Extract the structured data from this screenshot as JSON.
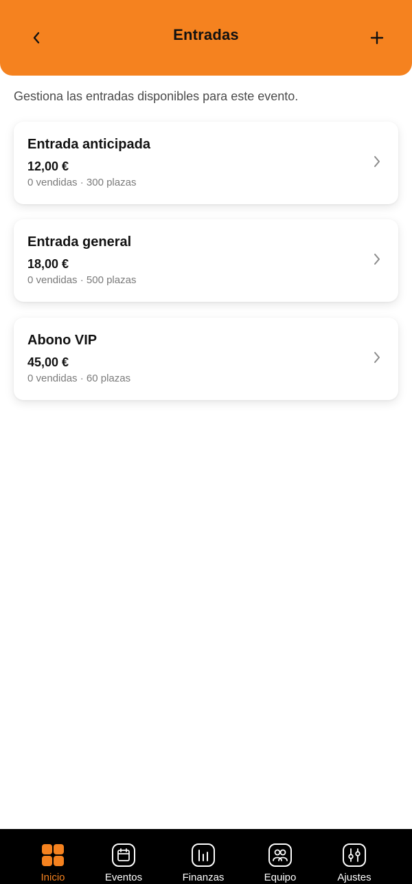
{
  "header": {
    "title": "Entradas",
    "back_icon": "chevron-left-icon",
    "add_icon": "plus-icon",
    "background_color": "#F5821F"
  },
  "subtitle": "Gestiona las entradas disponibles para este evento.",
  "tickets": [
    {
      "name": "Entrada anticipada",
      "price": "12,00 €",
      "meta": "0 vendidas · 300 plazas"
    },
    {
      "name": "Entrada general",
      "price": "18,00 €",
      "meta": "0 vendidas · 500 plazas"
    },
    {
      "name": "Abono VIP",
      "price": "45,00 €",
      "meta": "0 vendidas · 60 plazas"
    }
  ],
  "tabbar": {
    "active_color": "#F5821F",
    "items": [
      {
        "label": "Inicio",
        "icon": "grid-icon",
        "active": true
      },
      {
        "label": "Eventos",
        "icon": "calendar-icon",
        "active": false
      },
      {
        "label": "Finanzas",
        "icon": "bar-chart-icon",
        "active": false
      },
      {
        "label": "Equipo",
        "icon": "team-icon",
        "active": false
      },
      {
        "label": "Ajustes",
        "icon": "sliders-icon",
        "active": false
      }
    ]
  }
}
